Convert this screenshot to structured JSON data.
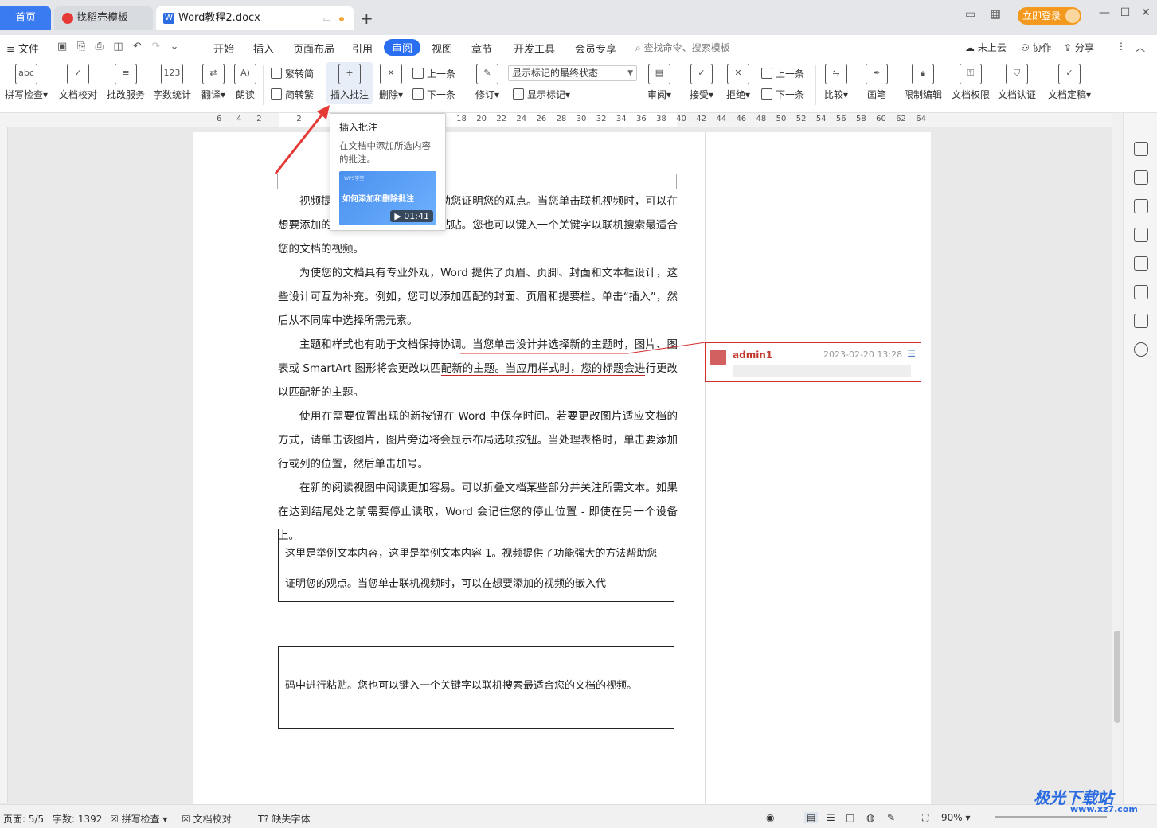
{
  "tabs": {
    "home": "首页",
    "template": "找稻壳模板",
    "doc": "Word教程2.docx"
  },
  "titlebar": {
    "login": "立即登录"
  },
  "menu": {
    "file": "文件",
    "items": [
      "开始",
      "插入",
      "页面布局",
      "引用",
      "审阅",
      "视图",
      "章节",
      "开发工具",
      "会员专享"
    ],
    "active": "审阅",
    "search": "查找命令、搜索模板",
    "cloud": "未上云",
    "collab": "协作",
    "share": "分享"
  },
  "ribbon": {
    "spell": "拼写检查",
    "doc_proof": "文档校对",
    "correct_service": "批改服务",
    "word_count": "字数统计",
    "translate": "翻译",
    "read_aloud": "朗读",
    "trad_to_simp": "繁转简",
    "simp_to_trad": "简转繁",
    "insert_comment": "插入批注",
    "delete": "删除",
    "prev": "上一条",
    "next": "下一条",
    "markup_select": "显示标记的最终状态",
    "revise": "修订",
    "show_markup": "显示标记",
    "review": "审阅",
    "accept": "接受",
    "reject": "拒绝",
    "prev2": "上一条",
    "next2": "下一条",
    "compare": "比较",
    "pen": "画笔",
    "restrict": "限制编辑",
    "permission": "文档权限",
    "certify": "文档认证",
    "finalize": "文档定稿"
  },
  "ruler": {
    "marks": [
      "6",
      "4",
      "2",
      "",
      "2",
      "",
      "",
      "",
      "",
      "",
      "",
      "",
      "18",
      "20",
      "22",
      "24",
      "26",
      "28",
      "30",
      "32",
      "34",
      "36",
      "38",
      "40",
      "42",
      "44",
      "46",
      "48",
      "50",
      "52",
      "54",
      "56",
      "58",
      "60",
      "62",
      "64"
    ]
  },
  "tooltip": {
    "title": "插入批注",
    "desc": "在文档中添加所选内容的批注。",
    "video_brand": "WPS学堂",
    "video_title": "如何添加和删除批注",
    "duration": "01:41"
  },
  "document": {
    "p1": "视频提供了功能强大的方法帮助您证明您的观点。当您单击联机视频时，可以在想要添加的视频的嵌入代码中进行粘贴。您也可以键入一个关键字以联机搜索最适合您的文档的视频。",
    "p2": "为使您的文档具有专业外观，Word 提供了页眉、页脚、封面和文本框设计，这些设计可互为补充。例如，您可以添加匹配的封面、页眉和提要栏。单击“插入”，然后从不同库中选择所需元素。",
    "p3a": "主题和样式也有助于文档保持协调。当您单击设计并选择新的主题时，图片、图表或 SmartArt 图形将会更改以匹",
    "p3b": "配新的主题。当应用样式时，您的标题会进",
    "p3c": "行更改以匹配新的主题。",
    "p4": "使用在需要位置出现的新按钮在 Word 中保存时间。若要更改图片适应文档的方式，请单击该图片，图片旁边将会显示布局选项按钮。当处理表格时，单击要添加行或列的位置，然后单击加号。",
    "p5": "在新的阅读视图中阅读更加容易。可以折叠文档某些部分并关注所需文本。如果在达到结尾处之前需要停止读取，Word 会记住您的停止位置 - 即使在另一个设备上。",
    "box1": "这里是举例文本内容，这里是举例文本内容 1。视频提供了功能强大的方法帮助您证明您的观点。当您单击联机视频时，可以在想要添加的视频的嵌入代",
    "box2": "码中进行粘贴。您也可以键入一个关键字以联机搜索最适合您的文档的视频。"
  },
  "comment": {
    "author": "admin1",
    "time": "2023-02-20 13:28"
  },
  "status": {
    "page": "页面: 5/5",
    "words": "字数: 1392",
    "spell": "拼写检查",
    "proof": "文档校对",
    "missing_font": "缺失字体",
    "zoom": "90%"
  },
  "watermark": {
    "name": "极光下载站",
    "url": "www.xz7.com"
  },
  "colors": {
    "accent": "#2a6ff2",
    "comment_border": "#d32f2f",
    "arrow": "#e53935"
  }
}
